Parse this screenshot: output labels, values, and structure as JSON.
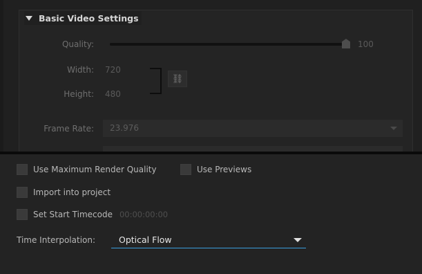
{
  "basic_video_settings": {
    "title": "Basic Video Settings",
    "quality_label": "Quality:",
    "quality_value": "100",
    "quality_level": 1.0,
    "width_label": "Width:",
    "width_value": "720",
    "height_label": "Height:",
    "height_value": "480",
    "link_icon": "chain-link-icon",
    "frame_rate_label": "Frame Rate:",
    "frame_rate_value": "23.976"
  },
  "options": {
    "max_render_quality_label": "Use Maximum Render Quality",
    "use_previews_label": "Use Previews",
    "import_into_project_label": "Import into project",
    "set_start_timecode_label": "Set Start Timecode",
    "start_timecode_value": "00:00:00:00",
    "time_interpolation_label": "Time Interpolation:",
    "time_interpolation_value": "Optical Flow"
  },
  "colors": {
    "background": "#232323",
    "focus_underline": "#3aa0e0"
  }
}
